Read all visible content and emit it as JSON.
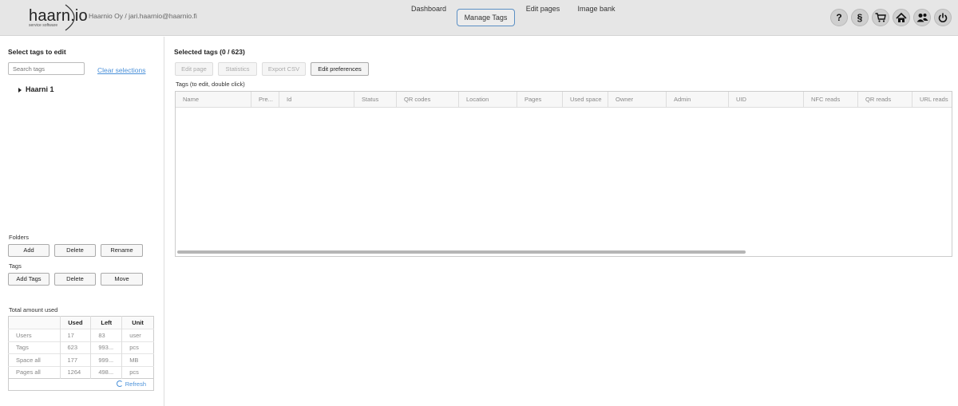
{
  "header": {
    "logo_text": "haarn.io",
    "logo_subtitle": "service software",
    "user_info": "Haarnio Oy / jari.haarnio@haarnio.fi",
    "nav": [
      {
        "label": "Dashboard",
        "active": false
      },
      {
        "label": "Manage Tags",
        "active": true
      },
      {
        "label": "Edit pages",
        "active": false
      },
      {
        "label": "Image bank",
        "active": false
      }
    ],
    "icons": [
      {
        "name": "help-icon",
        "glyph": "?"
      },
      {
        "name": "terms-icon",
        "glyph": "§"
      },
      {
        "name": "cart-icon",
        "glyph": "cart"
      },
      {
        "name": "home-icon",
        "glyph": "home"
      },
      {
        "name": "users-icon",
        "glyph": "users"
      },
      {
        "name": "power-icon",
        "glyph": "power"
      }
    ]
  },
  "left": {
    "title": "Select tags to edit",
    "search_placeholder": "Search tags",
    "clear_label": "Clear selections",
    "tree": [
      {
        "label": "Haarni 1",
        "expanded": false
      }
    ],
    "folders_label": "Folders",
    "folder_buttons": [
      "Add",
      "Delete",
      "Rename"
    ],
    "tags_label": "Tags",
    "tag_buttons": [
      "Add Tags",
      "Delete",
      "Move"
    ],
    "usage_title": "Total amount used",
    "usage_columns": [
      "",
      "Used",
      "Left",
      "Unit"
    ],
    "usage_rows": [
      [
        "Users",
        "17",
        "83",
        "user"
      ],
      [
        "Tags",
        "623",
        "993...",
        "pcs"
      ],
      [
        "Space all",
        "177",
        "999...",
        "MB"
      ],
      [
        "Pages all",
        "1264",
        "498...",
        "pcs"
      ]
    ],
    "refresh_label": "Refresh"
  },
  "main": {
    "title": "Selected tags (0 / 623)",
    "toolbar": [
      {
        "label": "Edit page",
        "enabled": false
      },
      {
        "label": "Statistics",
        "enabled": false
      },
      {
        "label": "Export CSV",
        "enabled": false
      },
      {
        "label": "Edit preferences",
        "enabled": true
      }
    ],
    "grid_caption": "Tags (to edit, double click)",
    "columns": [
      "Name",
      "Pre...",
      "Id",
      "Status",
      "QR codes",
      "Location",
      "Pages",
      "Used space",
      "Owner",
      "Admin",
      "UID",
      "NFC reads",
      "QR reads",
      "URL reads"
    ]
  },
  "colors": {
    "accent": "#4a90d9",
    "header_bg": "#e6e6e6",
    "active_border": "#5b8fc4"
  }
}
